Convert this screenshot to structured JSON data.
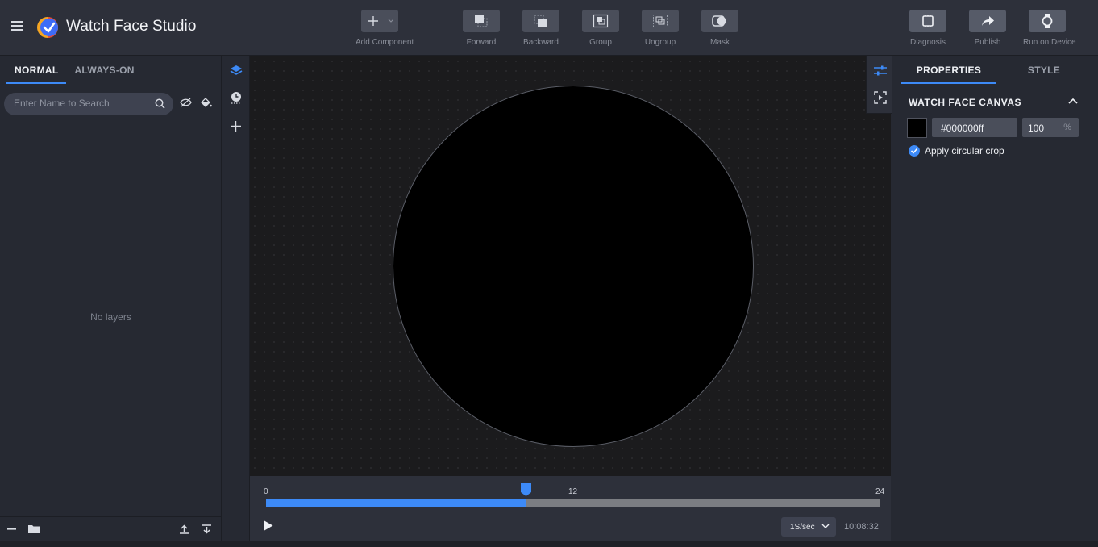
{
  "app": {
    "title": "Watch Face Studio"
  },
  "toolbar": {
    "add_component": "Add Component",
    "forward": "Forward",
    "backward": "Backward",
    "group": "Group",
    "ungroup": "Ungroup",
    "mask": "Mask",
    "diagnosis": "Diagnosis",
    "publish": "Publish",
    "run_on_device": "Run on Device"
  },
  "layers": {
    "tabs": [
      "NORMAL",
      "ALWAYS-ON"
    ],
    "active_tab": "NORMAL",
    "search_placeholder": "Enter Name to Search",
    "empty_text": "No layers"
  },
  "timeline": {
    "start": "0",
    "mid": "12",
    "end": "24",
    "position_hours": 10.14,
    "speed": "1S/sec",
    "time": "10:08:32"
  },
  "properties": {
    "tabs": [
      "PROPERTIES",
      "STYLE"
    ],
    "active_tab": "PROPERTIES",
    "section_title": "WATCH FACE CANVAS",
    "color_hex": "#000000ff",
    "opacity": "100",
    "opacity_unit": "%",
    "apply_crop_label": "Apply circular crop",
    "apply_crop_checked": true
  },
  "colors": {
    "accent": "#3d8af7",
    "canvas_bg": "#1b1b1d",
    "watch_face": "#000000"
  }
}
